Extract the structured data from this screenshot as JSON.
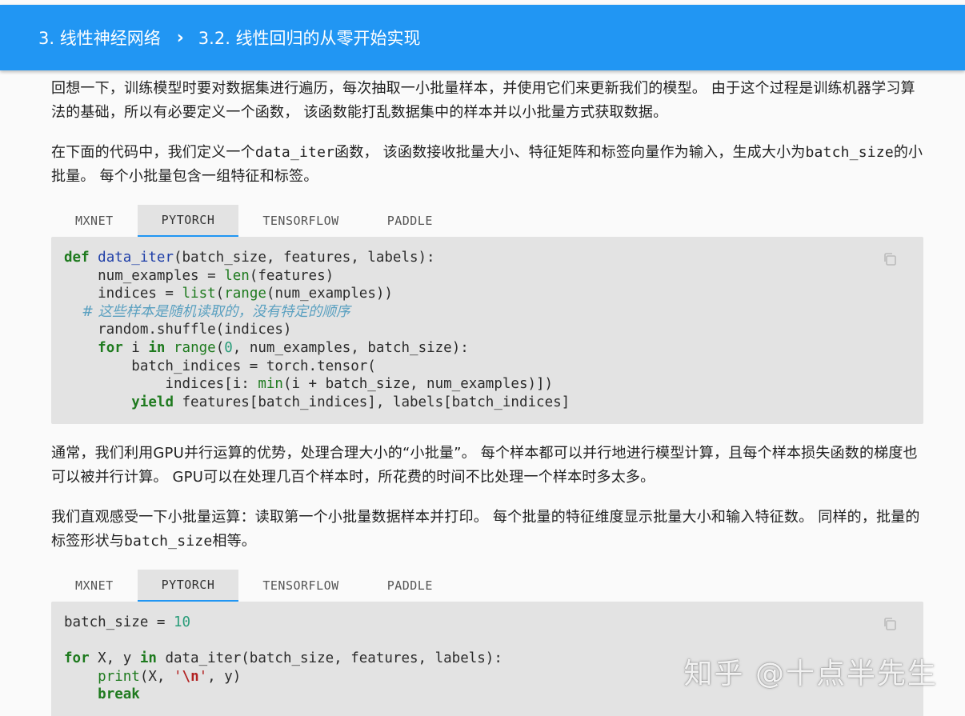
{
  "breadcrumb": {
    "chapter": "3. 线性神经网络",
    "separator": "›",
    "section": "3.2. 线性回归的从零开始实现"
  },
  "paragraphs": {
    "p1": "回想一下，训练模型时要对数据集进行遍历，每次抽取一小批量样本，并使用它们来更新我们的模型。 由于这个过程是训练机器学习算法的基础，所以有必要定义一个函数， 该函数能打乱数据集中的样本并以小批量方式获取数据。",
    "p2_before": "在下面的代码中，我们定义一个",
    "p2_code1": "data_iter",
    "p2_mid": "函数， 该函数接收批量大小、特征矩阵和标签向量作为输入，生成大小为",
    "p2_code2": "batch_size",
    "p2_after": "的小批量。 每个小批量包含一组特征和标签。",
    "p3": "通常，我们利用GPU并行运算的优势，处理合理大小的“小批量”。 每个样本都可以并行地进行模型计算，且每个样本损失函数的梯度也可以被并行计算。 GPU可以在处理几百个样本时，所花费的时间不比处理一个样本时多太多。",
    "p4_before": "我们直观感受一下小批量运算：读取第一个小批量数据样本并打印。 每个批量的特征维度显示批量大小和输入特征数。 同样的，批量的标签形状与",
    "p4_code": "batch_size",
    "p4_after": "相等。"
  },
  "tabs": [
    "MXNET",
    "PYTORCH",
    "TENSORFLOW",
    "PADDLE"
  ],
  "active_tab": "PYTORCH",
  "code1": {
    "l1_def": "def",
    "l1_name": "data_iter",
    "l1_rest": "(batch_size, features, labels):",
    "l2_a": "    num_examples = ",
    "l2_len": "len",
    "l2_b": "(features)",
    "l3_a": "    indices = ",
    "l3_list": "list",
    "l3_b": "(",
    "l3_range": "range",
    "l3_c": "(num_examples))",
    "l4_comment": "    # 这些样本是随机读取的，没有特定的顺序",
    "l5": "    random.shuffle(indices)",
    "l6_for": "for",
    "l6_i": " i ",
    "l6_in": "in",
    "l6_sp": " ",
    "l6_range": "range",
    "l6_open": "(",
    "l6_zero": "0",
    "l6_rest": ", num_examples, batch_size):",
    "l7": "        batch_indices = torch.tensor(",
    "l8_a": "            indices[i: ",
    "l8_min": "min",
    "l8_b": "(i + batch_size, num_examples)])",
    "l9_yield": "yield",
    "l9_rest": " features[batch_indices], labels[batch_indices]"
  },
  "code2": {
    "l1_a": "batch_size = ",
    "l1_num": "10",
    "l3_for": "for",
    "l3_mid": " X, y ",
    "l3_in": "in",
    "l3_rest": " data_iter(batch_size, features, labels):",
    "l4_print": "print",
    "l4_a": "(X, ",
    "l4_q1": "'",
    "l4_esc": "\\n",
    "l4_q2": "'",
    "l4_b": ", y)",
    "l5_break": "break"
  },
  "watermark": "知乎 @十点半先生",
  "colors": {
    "header_bg": "#2196f3",
    "code_bg": "#e3e3e3",
    "tab_active_underline": "#2196f3"
  }
}
